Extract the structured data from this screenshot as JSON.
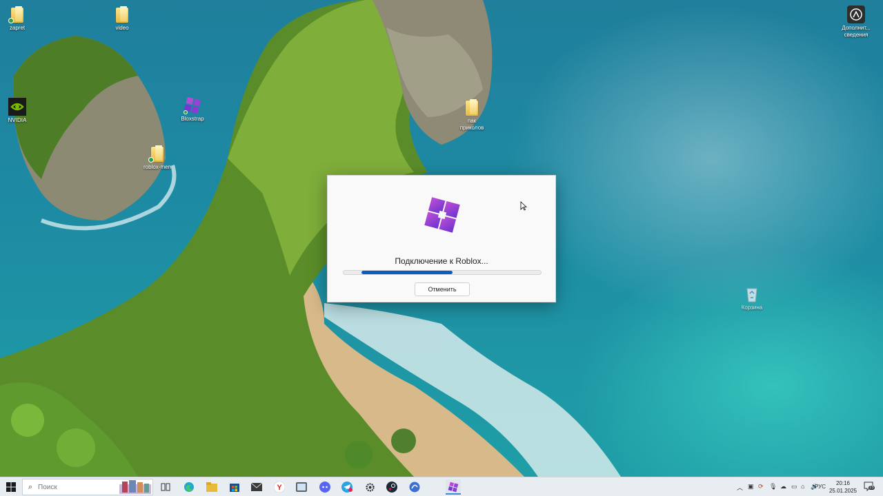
{
  "desktop": {
    "icons": [
      {
        "label": "zapret",
        "type": "folder"
      },
      {
        "label": "video",
        "type": "folder"
      },
      {
        "label": "NVIDIA",
        "type": "app"
      },
      {
        "label": "Bloxstrap",
        "type": "app"
      },
      {
        "label": "roblox-men",
        "type": "folder"
      },
      {
        "label": "пак приколов",
        "type": "folder"
      },
      {
        "label": "Корзина",
        "type": "recycle-bin"
      },
      {
        "label": "Дополнит... сведения",
        "type": "app"
      }
    ]
  },
  "dialog": {
    "status_text": "Подключение к Roblox...",
    "progress": 0.46,
    "cancel_label": "Отменить"
  },
  "taskbar": {
    "search_placeholder": "Поиск",
    "apps": [
      "task-view",
      "edge",
      "file-explorer",
      "store",
      "mail",
      "yandex",
      "tablet",
      "discord",
      "telegram",
      "settings",
      "steam",
      "browser",
      "bloxstrap"
    ],
    "tray": {
      "language": "РУС",
      "time": "20:16",
      "date": "25.01.2025",
      "notification_count": "15"
    }
  },
  "colors": {
    "accent": "#0a5dc2",
    "bloxstrap_purple": "#8c35d6"
  }
}
